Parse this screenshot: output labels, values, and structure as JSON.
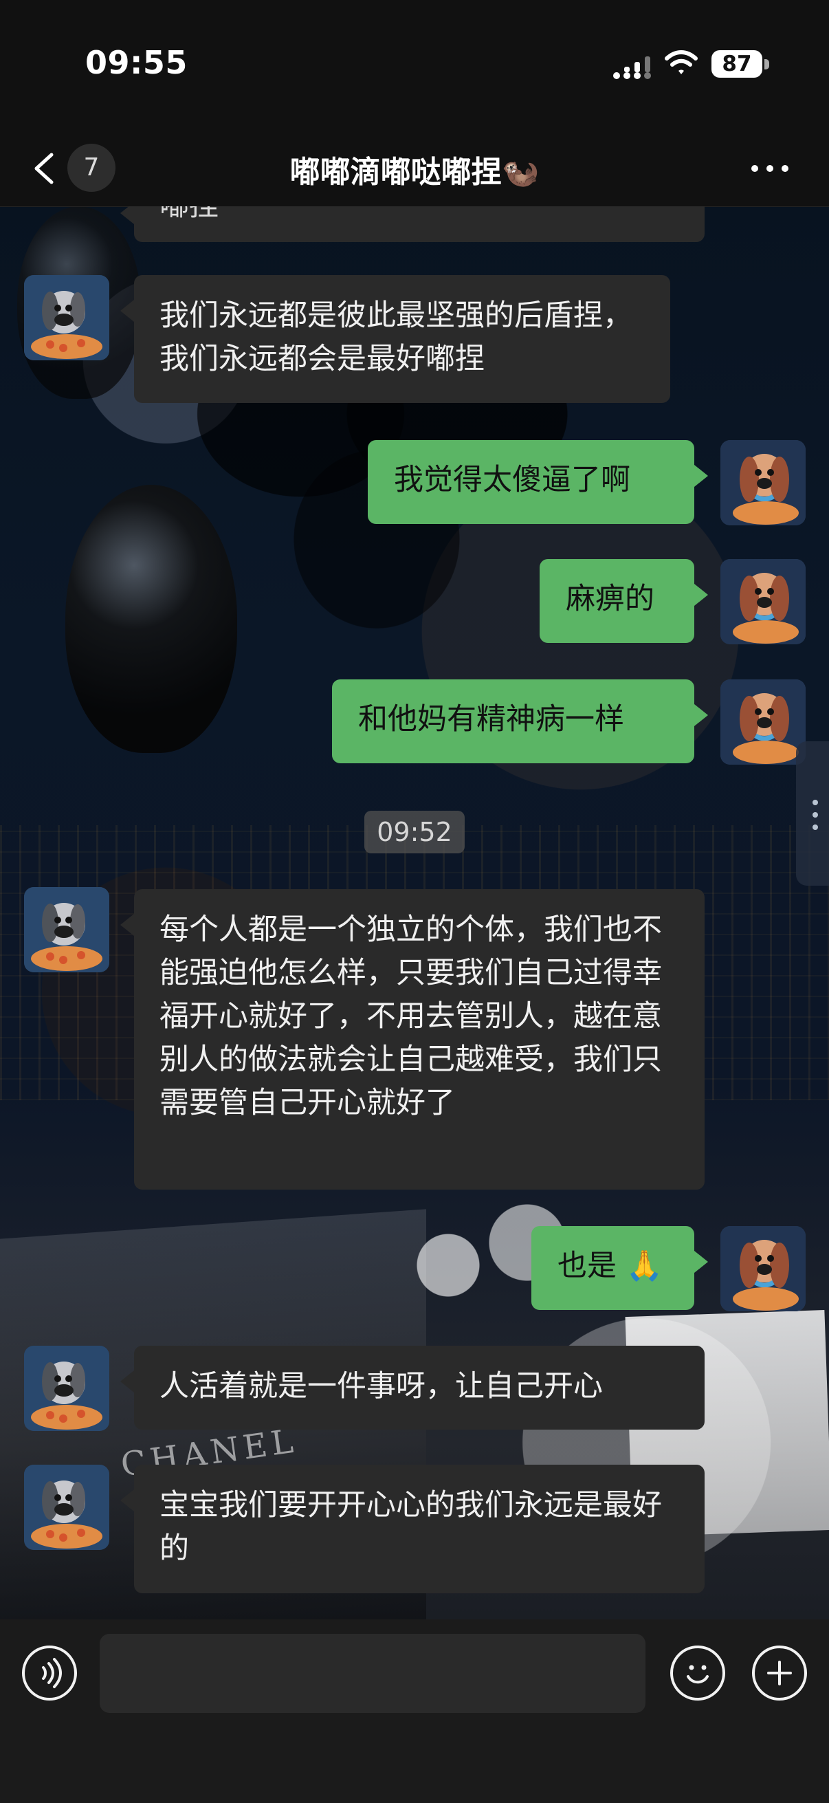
{
  "status": {
    "time": "09:55",
    "battery": "87"
  },
  "header": {
    "back_count": "7",
    "title": "嘟嘟滴嘟哒嘟捏🦦"
  },
  "messages": [
    {
      "side": "left",
      "text": "我们永远都是彼此最坚强的后盾捏，我们永远都会是最好嘟捏"
    },
    {
      "side": "right",
      "text": "我觉得太傻逼了啊"
    },
    {
      "side": "right",
      "text": "麻痹的"
    },
    {
      "side": "right",
      "text": "和他妈有精神病一样"
    },
    {
      "side": "time",
      "text": "09:52"
    },
    {
      "side": "left",
      "text": "每个人都是一个独立的个体，我们也不能强迫他怎么样，只要我们自己过得幸福开心就好了，不用去管别人，越在意别人的做法就会让自己越难受，我们只需要管自己开心就好了"
    },
    {
      "side": "right",
      "text": "也是 🙏"
    },
    {
      "side": "left",
      "text": "人活着就是一件事呀，让自己开心"
    },
    {
      "side": "left",
      "text": "宝宝我们要开开心心的我们永远是最好的"
    }
  ],
  "partial_top_text": "嘟捏",
  "background_brand": "CHANEL",
  "input": {
    "placeholder": ""
  },
  "icons": {
    "back": "chevron-left-icon",
    "more": "more-horizontal-icon",
    "voice": "voice-icon",
    "emoji": "emoji-icon",
    "plus": "plus-icon"
  }
}
